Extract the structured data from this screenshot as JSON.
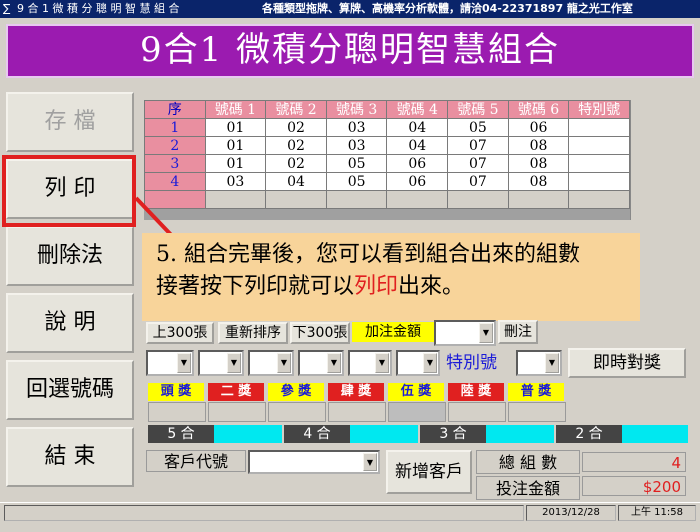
{
  "window": {
    "title": "9 合 1 微 積 分 聰 明 智 慧 組 合",
    "title_right": "各種類型拖牌、算牌、高機率分析軟體，請洽04-22371897 龍之光工作室"
  },
  "banner": {
    "text": "9合1 微積分聰明智慧組合"
  },
  "sidebar": {
    "items": [
      {
        "label": "存 檔"
      },
      {
        "label": "列 印"
      },
      {
        "label": "刪除法"
      },
      {
        "label": "說 明"
      },
      {
        "label": "回選號碼"
      },
      {
        "label": "結 束"
      }
    ]
  },
  "grid": {
    "headers": [
      "序",
      "號碼 1",
      "號碼 2",
      "號碼 3",
      "號碼 4",
      "號碼 5",
      "號碼 6",
      "特別號"
    ],
    "rows": [
      [
        "1",
        "01",
        "02",
        "03",
        "04",
        "05",
        "06",
        ""
      ],
      [
        "2",
        "01",
        "02",
        "03",
        "04",
        "07",
        "08",
        ""
      ],
      [
        "3",
        "01",
        "02",
        "05",
        "06",
        "07",
        "08",
        ""
      ],
      [
        "4",
        "03",
        "04",
        "05",
        "06",
        "07",
        "08",
        ""
      ]
    ]
  },
  "tip": {
    "line1": "5. 組合完畢後，您可以看到組合出來的組數",
    "line2a": "接著按下列印就可以",
    "line2_red": "列印",
    "line2b": "出來。"
  },
  "toolbar": {
    "prev300": "上300張",
    "resort": "重新排序",
    "next300": "下300張",
    "add_amount": "加注金額",
    "remove": "刪注"
  },
  "check": {
    "special_label": "特別號",
    "instant_button": "即時對獎"
  },
  "prizes": [
    {
      "label": "頭 獎",
      "color": "#1a1ad8"
    },
    {
      "label": "二 獎",
      "color": "#e02020"
    },
    {
      "label": "參 獎",
      "color": "#1a1ad8"
    },
    {
      "label": "肆 獎",
      "color": "#e02020"
    },
    {
      "label": "伍 獎",
      "color": "#1a1ad8"
    },
    {
      "label": "陸 獎",
      "color": "#e02020"
    },
    {
      "label": "普 獎",
      "color": "#1a1ad8"
    }
  ],
  "hits": [
    {
      "label": "5 合"
    },
    {
      "label": "4 合"
    },
    {
      "label": "3 合"
    },
    {
      "label": "2 合"
    }
  ],
  "customer": {
    "label": "客戶代號",
    "add_button": "新增客戶"
  },
  "summary": {
    "total_label": "總 組 數",
    "total_value": "4",
    "amount_label": "投注金額",
    "amount_value": "$200"
  },
  "status": {
    "date": "2013/12/28",
    "time": "上午 11:58"
  }
}
